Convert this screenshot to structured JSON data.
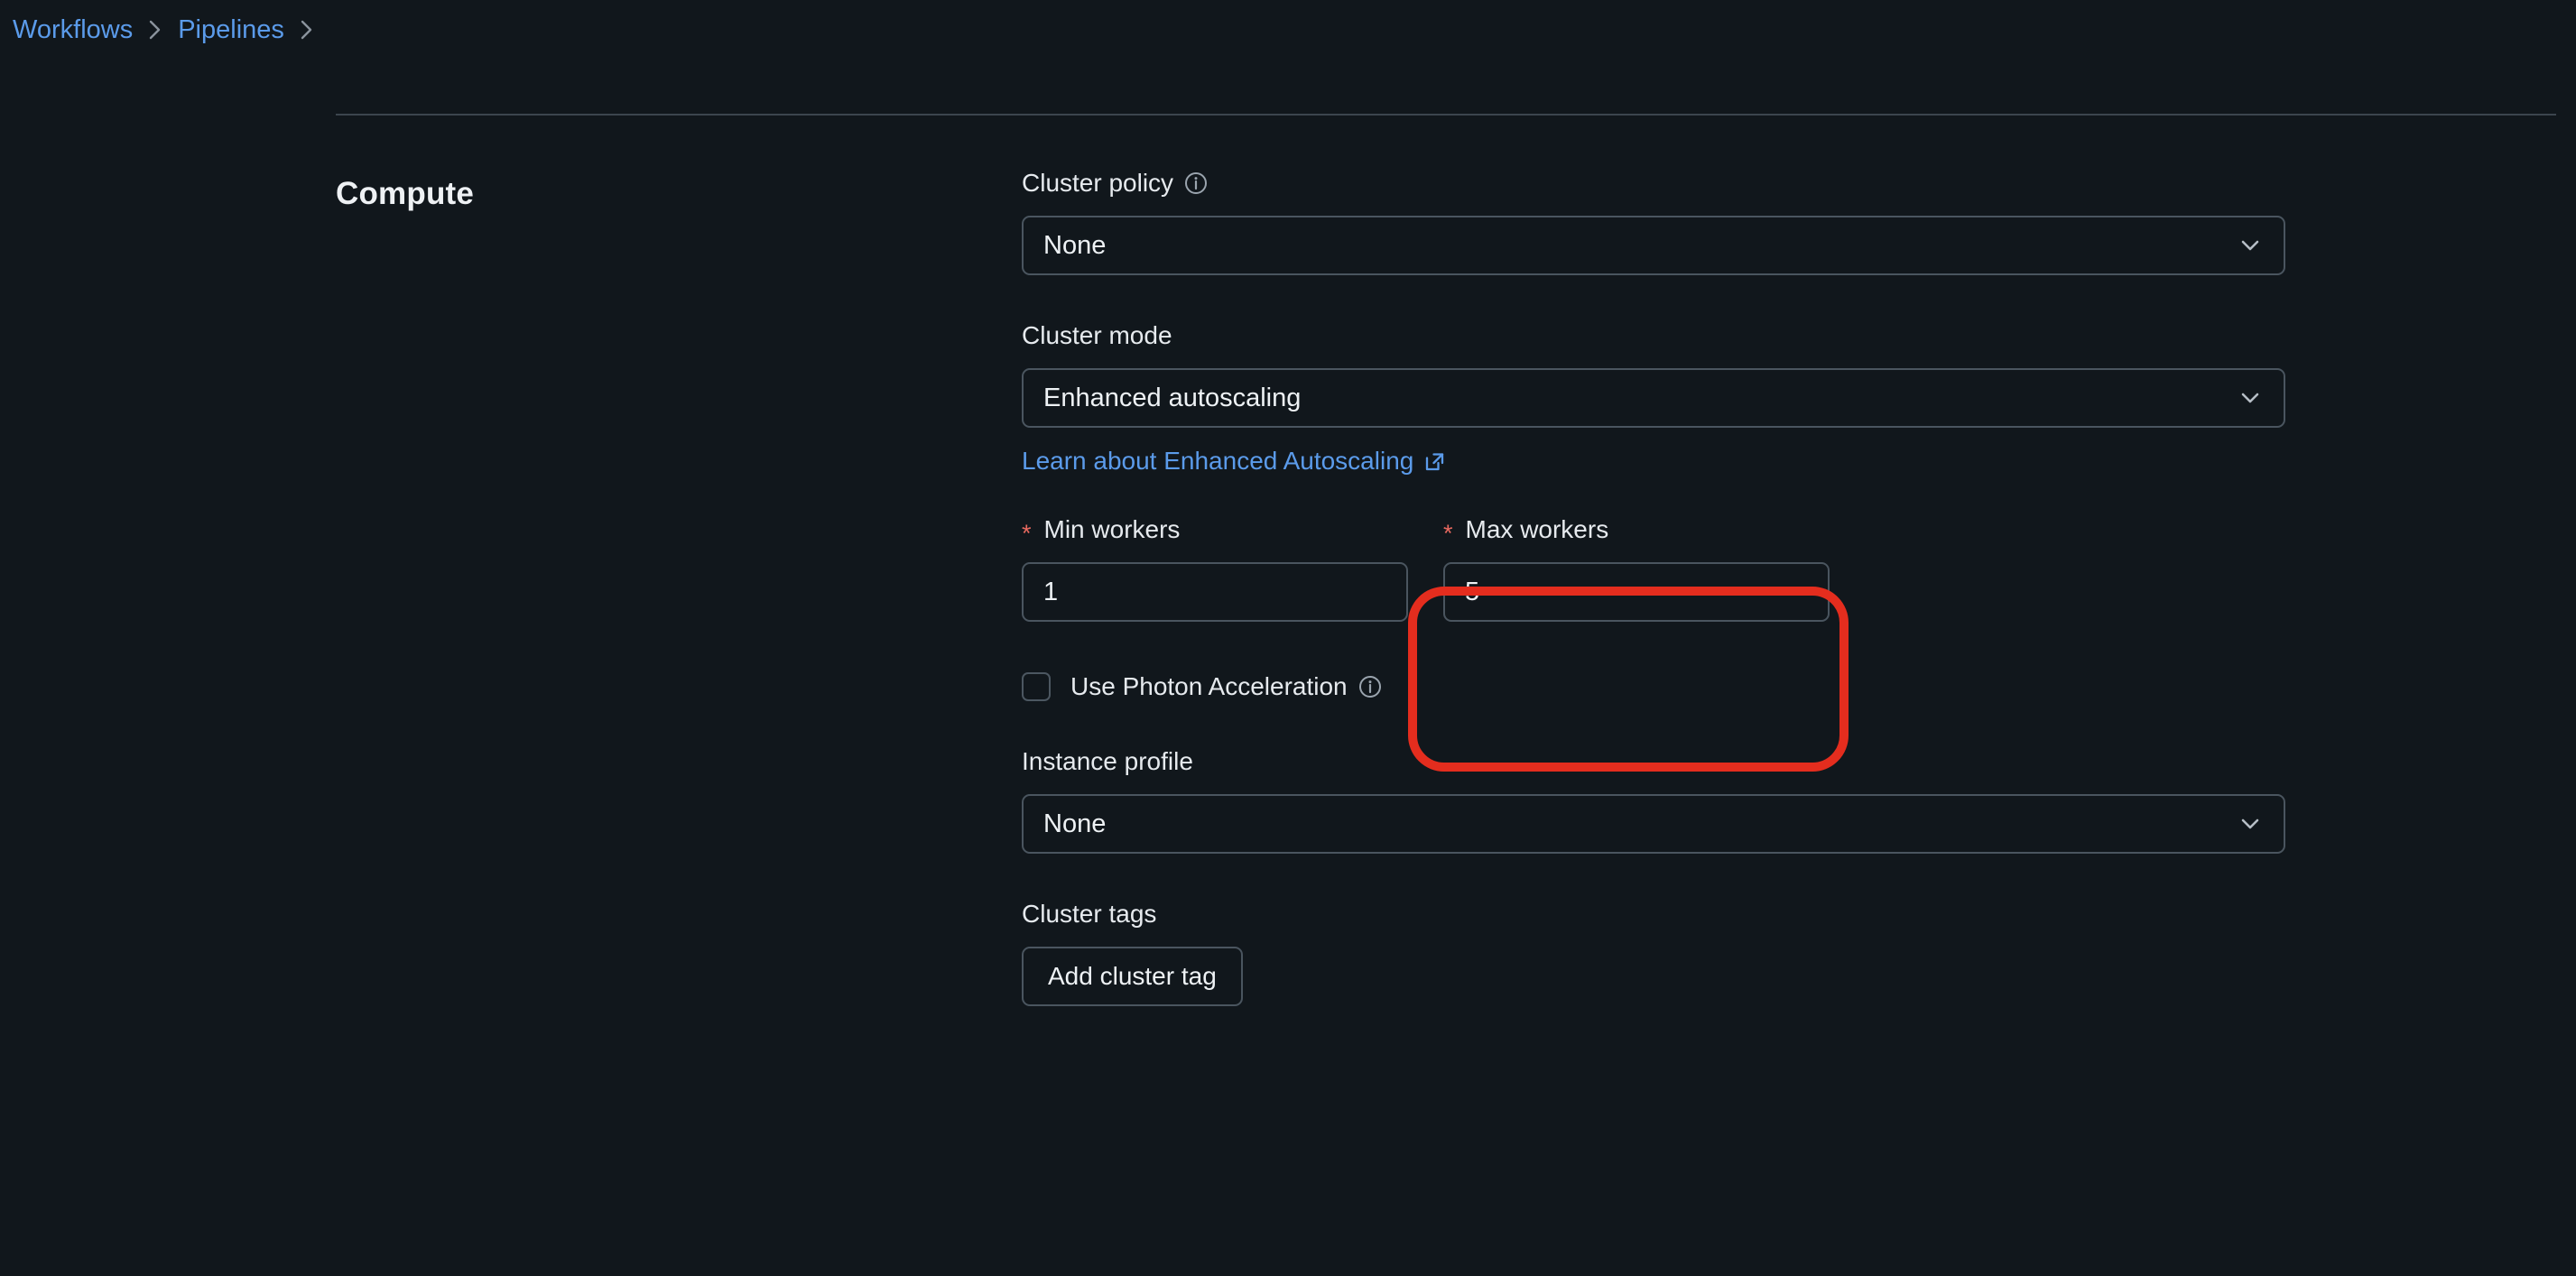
{
  "breadcrumb": {
    "items": [
      {
        "label": "Workflows"
      },
      {
        "label": "Pipelines"
      }
    ],
    "separator": "chevron-right-icon"
  },
  "section": {
    "title": "Compute"
  },
  "form": {
    "cluster_policy": {
      "label": "Cluster policy",
      "info_icon": "info-icon",
      "value": "None",
      "chevron": "chevron-down-icon"
    },
    "cluster_mode": {
      "label": "Cluster mode",
      "value": "Enhanced autoscaling",
      "chevron": "chevron-down-icon",
      "help_link": "Learn about Enhanced Autoscaling",
      "help_link_icon": "external-link-icon"
    },
    "min_workers": {
      "label": "Min workers",
      "required_marker": "*",
      "value": "1"
    },
    "max_workers": {
      "label": "Max workers",
      "required_marker": "*",
      "value": "5",
      "highlighted": true,
      "highlight_color": "#e42d1e"
    },
    "photon": {
      "label": "Use Photon Acceleration",
      "info_icon": "info-icon",
      "checked": false
    },
    "instance_profile": {
      "label": "Instance profile",
      "value": "None",
      "chevron": "chevron-down-icon"
    },
    "cluster_tags": {
      "label": "Cluster tags",
      "add_button": "Add cluster tag"
    }
  },
  "colors": {
    "background": "#11171c",
    "link": "#5b9bea",
    "border": "#4a555f",
    "text": "#e8ecf0",
    "required_star": "#e8695f",
    "annotation": "#e42d1e"
  }
}
